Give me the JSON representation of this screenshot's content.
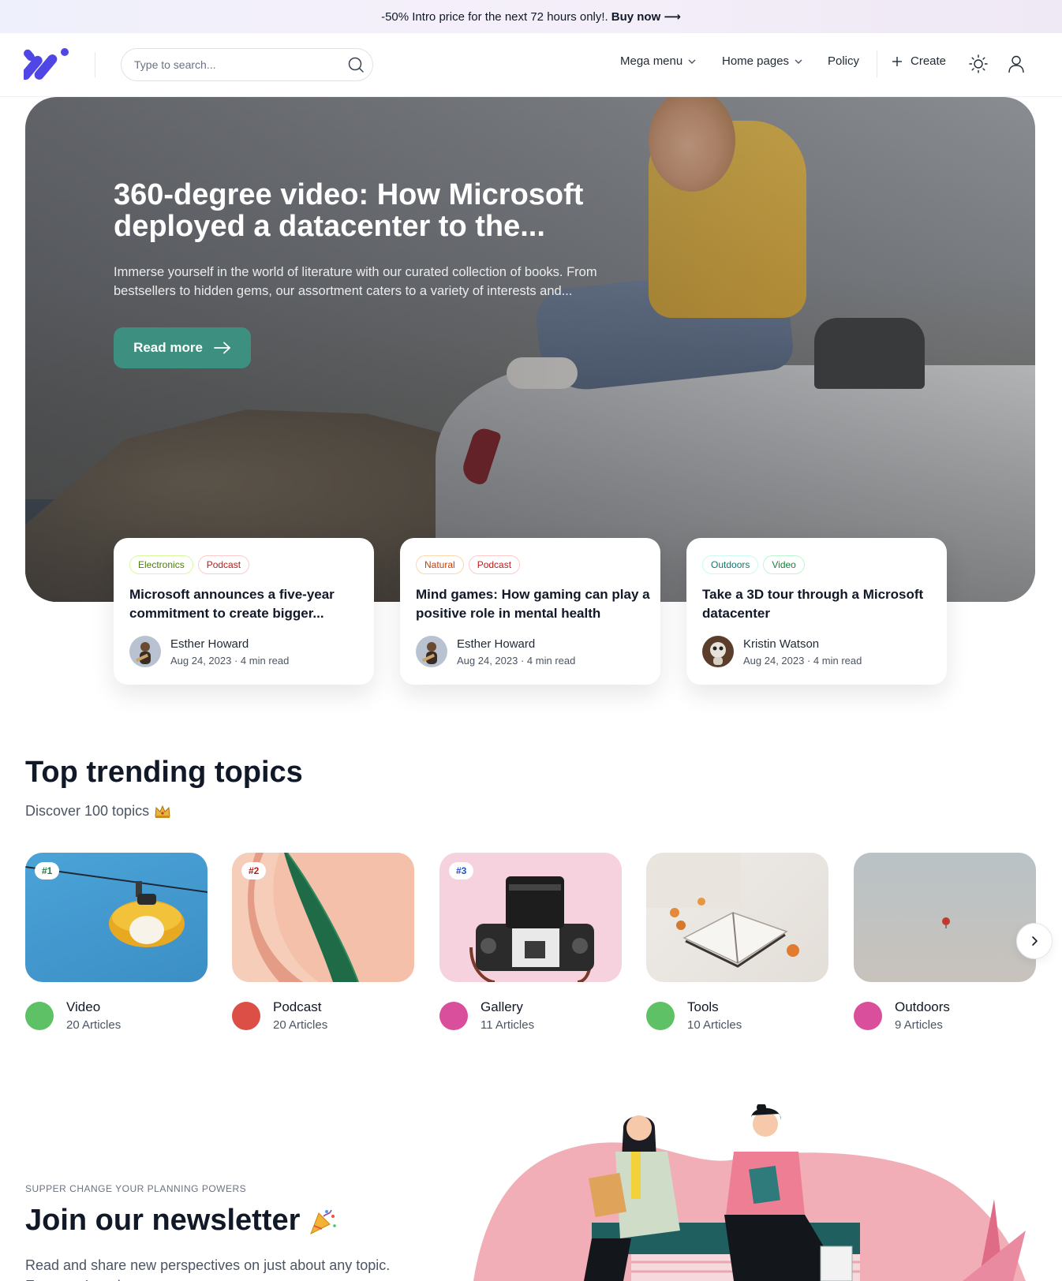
{
  "promo": {
    "text": "-50% Intro price for the next 72 hours only!.",
    "cta": "Buy now ⟶"
  },
  "header": {
    "logo": "logo-mark",
    "search": {
      "placeholder": "Type to search...",
      "icon": "search-icon"
    },
    "nav": [
      {
        "label": "Mega menu",
        "icon": "chevron-down-icon"
      },
      {
        "label": "Home pages",
        "icon": "chevron-down-icon"
      },
      {
        "label": "Policy"
      }
    ],
    "create_label": "Create",
    "theme_icon": "sun-icon",
    "user_icon": "user-icon"
  },
  "hero": {
    "title": "360-degree video: How Microsoft deployed a datacenter to the...",
    "description": "Immerse yourself in the world of literature with our curated collection of books. From bestsellers to hidden gems, our assortment caters to a variety of interests and...",
    "button": "Read more",
    "button_icon": "arrow-right-icon"
  },
  "cards": [
    {
      "tags": [
        {
          "label": "Electronics",
          "color": "#4d7c0f"
        },
        {
          "label": "Podcast",
          "color": "#b91c1c"
        }
      ],
      "title": "Microsoft announces a five-year commitment to create bigger...",
      "author": "Esther Howard",
      "date": "Aug 24, 2023",
      "read": "4 min read"
    },
    {
      "tags": [
        {
          "label": "Natural",
          "color": "#c2410c"
        },
        {
          "label": "Podcast",
          "color": "#b91c1c"
        }
      ],
      "title": "Mind games: How gaming can play a positive role in mental health",
      "author": "Esther Howard",
      "date": "Aug 24, 2023",
      "read": "4 min read"
    },
    {
      "tags": [
        {
          "label": "Outdoors",
          "color": "#0f766e"
        },
        {
          "label": "Video",
          "color": "#15803d"
        }
      ],
      "title": "Take a 3D tour through a Microsoft datacenter",
      "author": "Kristin Watson",
      "date": "Aug 24, 2023",
      "read": "4 min read"
    }
  ],
  "trending": {
    "title": "Top trending topics",
    "subtitle": "Discover 100 topics",
    "subtitle_icon": "crown-emoji",
    "topics": [
      {
        "rank": "#1",
        "name": "Video",
        "count": "20 Articles",
        "color": "#5fc165",
        "rank_color": "#15803d"
      },
      {
        "rank": "#2",
        "name": "Podcast",
        "count": "20 Articles",
        "color": "#dc4f47",
        "rank_color": "#b91c1c"
      },
      {
        "rank": "#3",
        "name": "Gallery",
        "count": "11 Articles",
        "color": "#d94f9b",
        "rank_color": "#1d4ed8"
      },
      {
        "name": "Tools",
        "count": "10 Articles",
        "color": "#5fc165"
      },
      {
        "name": "Outdoors",
        "count": "9 Articles",
        "color": "#d94f9b"
      }
    ],
    "next_icon": "chevron-right-icon"
  },
  "newsletter": {
    "kicker": "SUPPER CHANGE YOUR PLANNING POWERS",
    "title": "Join our newsletter",
    "title_icon": "party-popper-emoji",
    "description": "Read and share new perspectives on just about any topic. Everyone’s welcome."
  },
  "colors": {
    "accent": "#3d8f80",
    "logo": "#4f46e5",
    "illustration_pink": "#f2aeb6"
  }
}
